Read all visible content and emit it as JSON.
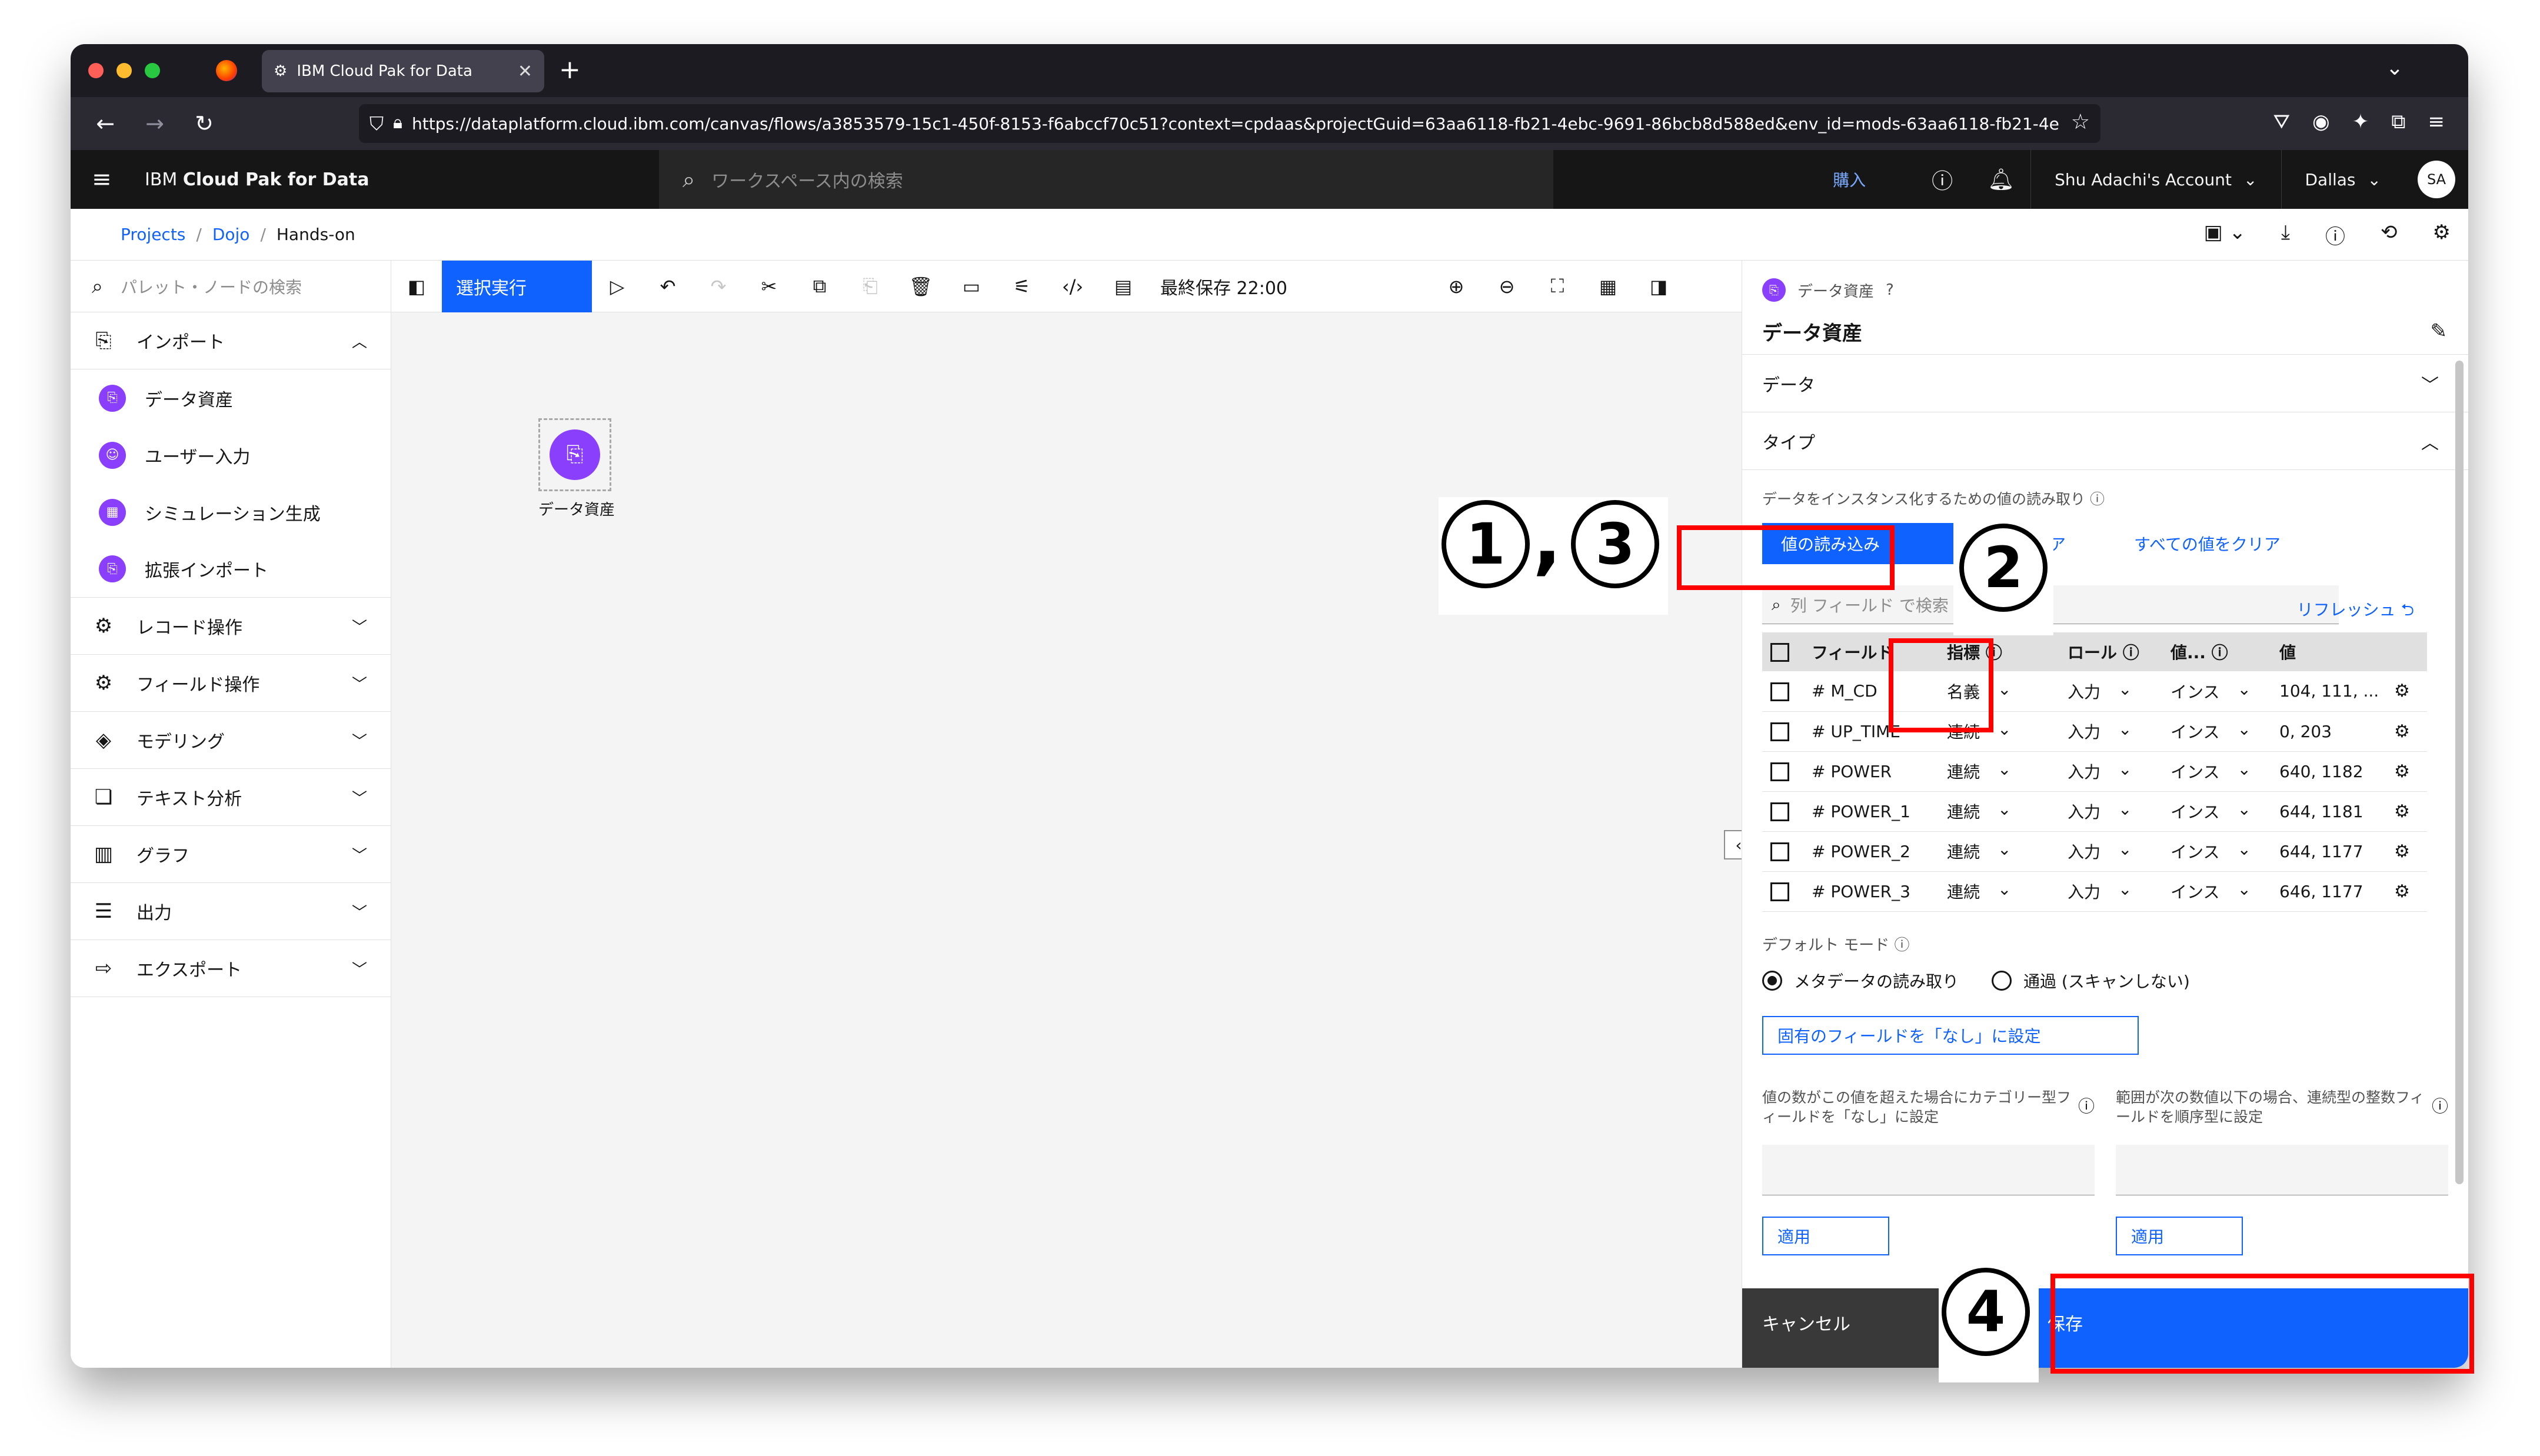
{
  "browser": {
    "tab_title": "IBM Cloud Pak for Data",
    "url_prefix": "https://dataplatform.cloud.",
    "url_domain": "ibm.com",
    "url_rest": "/canvas/flows/a3853579-15c1-450f-8153-f6abccf70c51?context=cpdaas&projectGuid=63aa6118-fb21-4ebc-9691-86bcb8d588ed&env_id=mods-63aa6118-fb21-4e"
  },
  "header": {
    "brand_prefix": "IBM ",
    "brand_name": "Cloud Pak for Data",
    "search_placeholder": "ワークスペース内の検索",
    "buy": "購入",
    "account": "Shu Adachi's Account",
    "region": "Dallas",
    "avatar": "SA"
  },
  "breadcrumb": [
    "Projects",
    "Dojo",
    "Hands-on"
  ],
  "palette": {
    "search_placeholder": "パレット・ノードの検索",
    "categories": [
      {
        "label": "インポート",
        "icon": "import-icon",
        "expanded": true
      },
      {
        "label": "レコード操作",
        "icon": "record-ops-icon"
      },
      {
        "label": "フィールド操作",
        "icon": "field-ops-icon"
      },
      {
        "label": "モデリング",
        "icon": "modeling-icon"
      },
      {
        "label": "テキスト分析",
        "icon": "text-analysis-icon"
      },
      {
        "label": "グラフ",
        "icon": "chart-icon"
      },
      {
        "label": "出力",
        "icon": "output-icon"
      },
      {
        "label": "エクスポート",
        "icon": "export-icon"
      }
    ],
    "import_items": [
      "データ資産",
      "ユーザー入力",
      "シミュレーション生成",
      "拡張インポート"
    ]
  },
  "toolbar": {
    "run_label": "選択実行",
    "last_saved": "最終保存 22:00"
  },
  "canvas": {
    "node_label": "データ資産"
  },
  "panel": {
    "kind": "データ資産",
    "title": "データ資産",
    "section_data": "データ",
    "section_type": "タイプ",
    "read_desc": "データをインスタンス化するための値の読み取り",
    "read_values_btn": "値の読み込み",
    "clear_values_link": "値をクリア",
    "clear_all_link": "すべての値をクリア",
    "field_search_placeholder": "列 フィールド で検索",
    "refresh": "リフレッシュ",
    "columns": [
      "フィールド",
      "指標",
      "ロール",
      "値...",
      "値"
    ],
    "rows": [
      {
        "field": "M_CD",
        "measure": "名義",
        "role": "入力",
        "instance": "インス",
        "values": "104, 111, ..."
      },
      {
        "field": "UP_TIME",
        "measure": "連続",
        "role": "入力",
        "instance": "インス",
        "values": "0, 203"
      },
      {
        "field": "POWER",
        "measure": "連続",
        "role": "入力",
        "instance": "インス",
        "values": "640, 1182"
      },
      {
        "field": "POWER_1",
        "measure": "連続",
        "role": "入力",
        "instance": "インス",
        "values": "644, 1181"
      },
      {
        "field": "POWER_2",
        "measure": "連続",
        "role": "入力",
        "instance": "インス",
        "values": "644, 1177"
      },
      {
        "field": "POWER_3",
        "measure": "連続",
        "role": "入力",
        "instance": "インス",
        "values": "646, 1177"
      }
    ],
    "default_mode_label": "デフォルト モード",
    "mode_read": "メタデータの読み取り",
    "mode_pass": "通過 (スキャンしない)",
    "set_none_btn": "固有のフィールドを「なし」に設定",
    "cat_threshold_label": "値の数がこの値を超えた場合にカテゴリー型フィールドを「なし」に設定",
    "ordinal_threshold_label": "範囲が次の数値以下の場合、連続型の整数フィールドを順序型に設定",
    "apply": "適用",
    "cancel": "キャンセル",
    "save": "保存"
  },
  "annotations": {
    "n1": "1",
    "n2": "2",
    "n3": "3",
    "n4": "4",
    "comma": ","
  },
  "colors": {
    "accent": "#0f62fe",
    "node": "#8a3ffc",
    "annotation": "#ff0000"
  }
}
